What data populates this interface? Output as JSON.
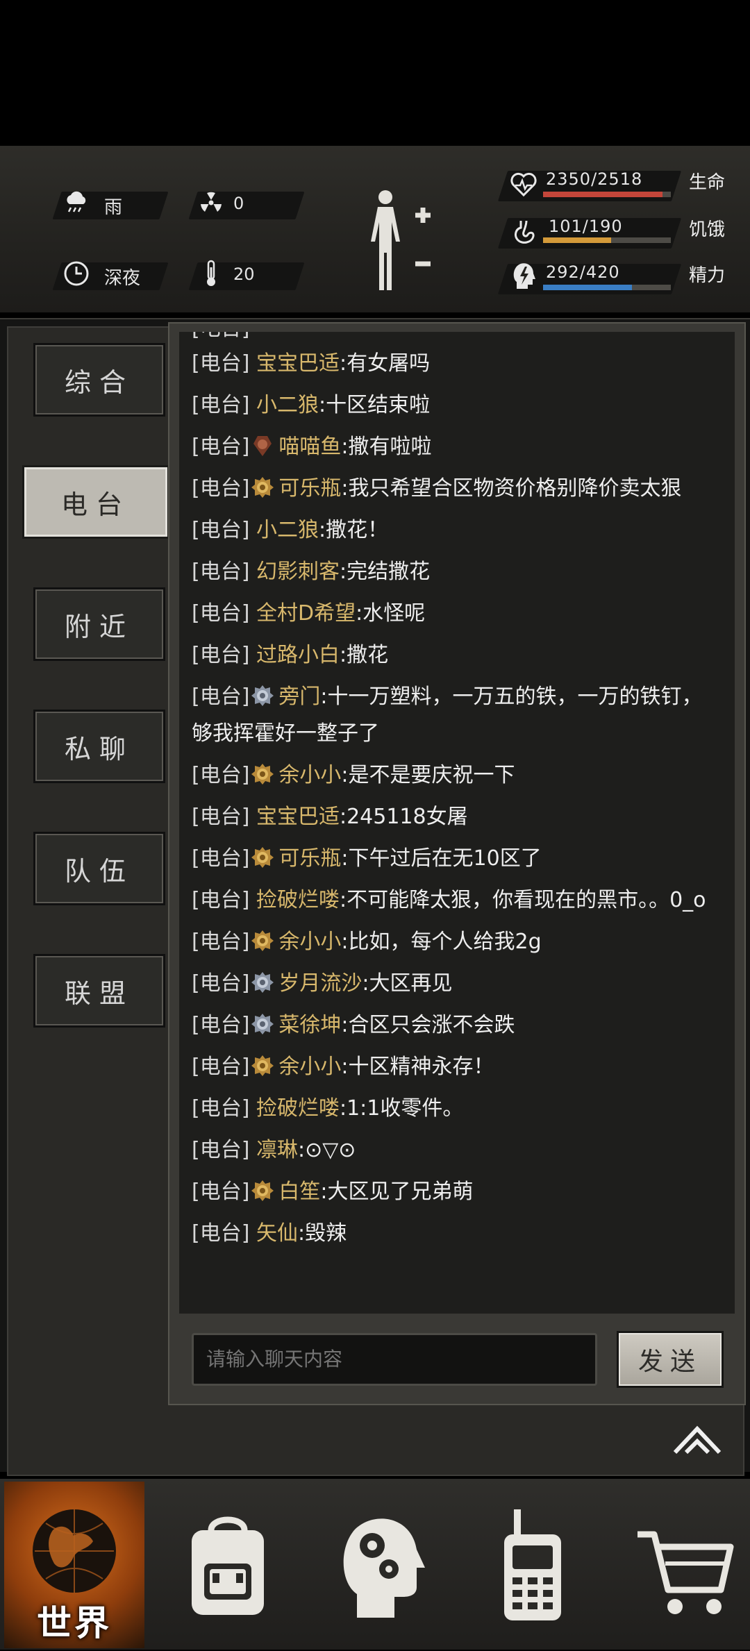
{
  "status": {
    "weather": "雨",
    "radiation": "0",
    "time_of_day": "深夜",
    "temperature": "20",
    "health": {
      "value": "2350/2518",
      "label": "生命",
      "fraction": 0.933,
      "color": "#c4463a"
    },
    "hunger": {
      "value": "101/190",
      "label": "饥饿",
      "fraction": 0.53,
      "color": "#d49a3a"
    },
    "energy": {
      "value": "292/420",
      "label": "精力",
      "fraction": 0.695,
      "color": "#3a7ec4"
    }
  },
  "tabs": [
    {
      "label": "综合",
      "active": false
    },
    {
      "label": "电台",
      "active": true
    },
    {
      "label": "附近",
      "active": false
    },
    {
      "label": "私聊",
      "active": false
    },
    {
      "label": "队伍",
      "active": false
    },
    {
      "label": "联盟",
      "active": false
    }
  ],
  "chat": {
    "channel_label": "[电台]",
    "messages": [
      {
        "name": "宝宝巴适",
        "text": ":有女屠吗",
        "badge": ""
      },
      {
        "name": "小二狼",
        "text": ":十区结束啦",
        "badge": ""
      },
      {
        "name": "喵喵鱼",
        "text": ":撒有啦啦",
        "badge": "bronze"
      },
      {
        "name": "可乐瓶",
        "text": ":我只希望合区物资价格别降价卖太狠",
        "badge": "gold"
      },
      {
        "name": "小二狼",
        "text": ":撒花！",
        "badge": ""
      },
      {
        "name": "幻影刺客",
        "text": ":完结撒花",
        "badge": ""
      },
      {
        "name": "全村D希望",
        "text": ":水怪呢",
        "badge": ""
      },
      {
        "name": "过路小白",
        "text": ":撒花",
        "badge": ""
      },
      {
        "name": "旁门",
        "text": ":十一万塑料，一万五的铁，一万的铁钉，够我挥霍好一整子了",
        "badge": "silver"
      },
      {
        "name": "余小小",
        "text": ":是不是要庆祝一下",
        "badge": "gold"
      },
      {
        "name": "宝宝巴适",
        "text": ":245118女屠",
        "badge": ""
      },
      {
        "name": "可乐瓶",
        "text": ":下午过后在无10区了",
        "badge": "gold"
      },
      {
        "name": "捡破烂喽",
        "text": ":不可能降太狠，你看现在的黑市。。0_o",
        "badge": ""
      },
      {
        "name": "余小小",
        "text": ":比如，每个人给我2g",
        "badge": "gold"
      },
      {
        "name": "岁月流沙",
        "text": ":大区再见",
        "badge": "silver"
      },
      {
        "name": "菜徐坤",
        "text": ":合区只会涨不会跌",
        "badge": "silver"
      },
      {
        "name": "余小小",
        "text": ":十区精神永存！",
        "badge": "gold"
      },
      {
        "name": "捡破烂喽",
        "text": ":1:1收零件。",
        "badge": ""
      },
      {
        "name": "凛琳",
        "text": ":⊙▽⊙",
        "badge": ""
      },
      {
        "name": "白笙",
        "text": ":大区见了兄弟萌",
        "badge": "gold"
      },
      {
        "name": "矢仙",
        "text": ":毁辣",
        "badge": ""
      }
    ],
    "input_placeholder": "请输入聊天内容",
    "send_label": "发送"
  },
  "nav": {
    "world_label": "世界",
    "items": [
      "world-icon",
      "backpack-icon",
      "skills-head-icon",
      "radio-phone-icon",
      "shop-cart-icon"
    ]
  }
}
